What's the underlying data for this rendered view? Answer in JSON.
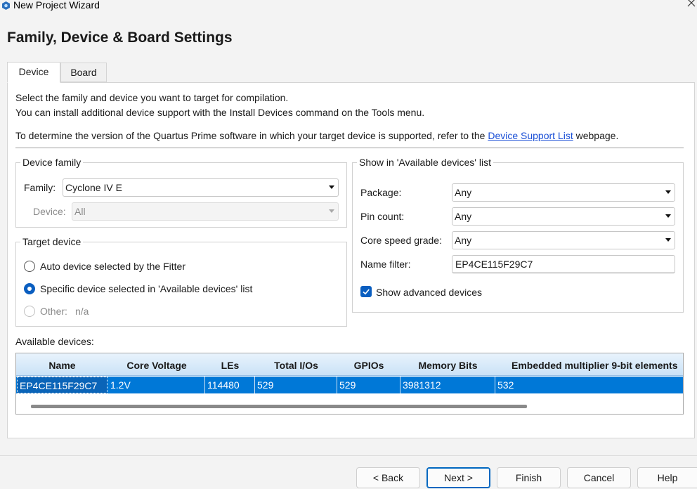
{
  "window": {
    "title": "New Project Wizard",
    "app_icon": "quartus-app-icon",
    "close_icon": "close-icon"
  },
  "page": {
    "heading": "Family, Device & Board Settings"
  },
  "tabs": [
    {
      "label": "Device",
      "active": true
    },
    {
      "label": "Board",
      "active": false
    }
  ],
  "intro": {
    "line1": "Select the family and device you want to target for compilation.",
    "line2": "You can install additional device support with the Install Devices command on the Tools menu.",
    "line3_prefix": "To determine the version of the Quartus Prime software in which your target device is supported, refer to the ",
    "line3_link": "Device Support List",
    "line3_suffix": " webpage."
  },
  "device_family": {
    "group_title": "Device family",
    "family_label": "Family:",
    "family_value": "Cyclone IV E",
    "device_label": "Device:",
    "device_value": "All"
  },
  "target_device": {
    "group_title": "Target device",
    "options": [
      {
        "label": "Auto device selected by the Fitter",
        "checked": false,
        "disabled": false
      },
      {
        "label": "Specific device selected in 'Available devices' list",
        "checked": true,
        "disabled": false
      },
      {
        "label": "Other:",
        "value": "n/a",
        "checked": false,
        "disabled": true
      }
    ]
  },
  "show_in": {
    "group_title": "Show in 'Available devices' list",
    "package_label": "Package:",
    "package_value": "Any",
    "pin_count_label": "Pin count:",
    "pin_count_value": "Any",
    "speed_label": "Core speed grade:",
    "speed_value": "Any",
    "name_filter_label": "Name filter:",
    "name_filter_value": "EP4CE115F29C7",
    "show_advanced_label": "Show advanced devices",
    "show_advanced_checked": true
  },
  "available_devices": {
    "label": "Available devices:",
    "columns": [
      "Name",
      "Core Voltage",
      "LEs",
      "Total I/Os",
      "GPIOs",
      "Memory Bits",
      "Embedded multiplier 9-bit elements"
    ],
    "rows": [
      [
        "EP4CE115F29C7",
        "1.2V",
        "114480",
        "529",
        "529",
        "3981312",
        "532"
      ]
    ],
    "selected_row": 0
  },
  "buttons": {
    "back": "< Back",
    "next": "Next >",
    "finish": "Finish",
    "cancel": "Cancel",
    "help": "Help"
  },
  "colors": {
    "accent": "#0078d7",
    "link": "#1a4fd6",
    "header_gradient_top": "#e9f3fc",
    "header_gradient_bottom": "#c9e2f7"
  }
}
